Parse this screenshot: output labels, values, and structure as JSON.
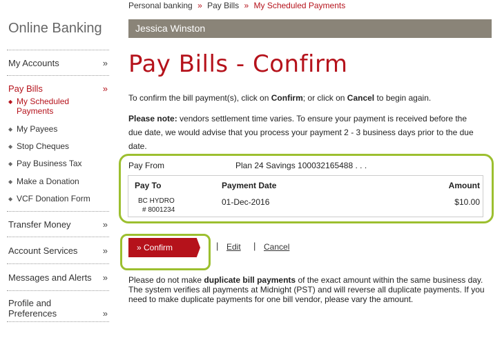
{
  "brand": "Online Banking",
  "breadcrumb": {
    "item1": "Personal banking",
    "item2": "Pay Bills",
    "current": "My Scheduled Payments",
    "sep": "»"
  },
  "user_name": "Jessica Winston",
  "page_title": "Pay Bills - Confirm",
  "intro": {
    "p1": "To confirm the bill payment(s), click on ",
    "confirm": "Confirm",
    "p2": "; or click on ",
    "cancel": "Cancel",
    "p3": " to begin again."
  },
  "note": {
    "label": "Please note:",
    "l1": " vendors settlement time varies. To ensure your payment is received before the",
    "l2": "due date, we would advise that you process your payment 2 - 3 business days prior to the due",
    "l3": "date."
  },
  "sidebar": {
    "chev": "»",
    "bullet": "◆",
    "my_accounts": "My Accounts",
    "pay_bills": "Pay Bills",
    "sub1": "My Scheduled",
    "sub1b": "Payments",
    "sub2": "My Payees",
    "sub3": "Stop Cheques",
    "sub4": "Pay Business Tax",
    "sub5": "Make a Donation",
    "sub6": "VCF Donation Form",
    "transfer": "Transfer Money",
    "services": "Account Services",
    "messages": "Messages and Alerts",
    "profile1": "Profile and",
    "profile2": "Preferences"
  },
  "payment": {
    "pay_from_label": "Pay From",
    "pay_from_value": "Plan 24 Savings 100032165488 . . .",
    "col_pay_to": "Pay To",
    "col_date": "Payment Date",
    "col_amount": "Amount",
    "payee": "BC HYDRO",
    "payee_no": "# 8001234",
    "date": "01-Dec-2016",
    "amount": "$10.00"
  },
  "actions": {
    "confirm": "» Confirm",
    "edit": "Edit",
    "cancel": "Cancel",
    "pipe": "|"
  },
  "warning": {
    "a": "Please do not make ",
    "b": "duplicate bill payments",
    "c": " of the exact amount within the same business day. The system verifies all payments at Midnight (PST) and will reverse all duplicate payments. If you need to make duplicate payments for one bill vendor, please vary the amount."
  },
  "colors": {
    "brand_red": "#b5121b",
    "highlight_green": "#9cbf2f",
    "bar_gray": "#8a8478"
  }
}
